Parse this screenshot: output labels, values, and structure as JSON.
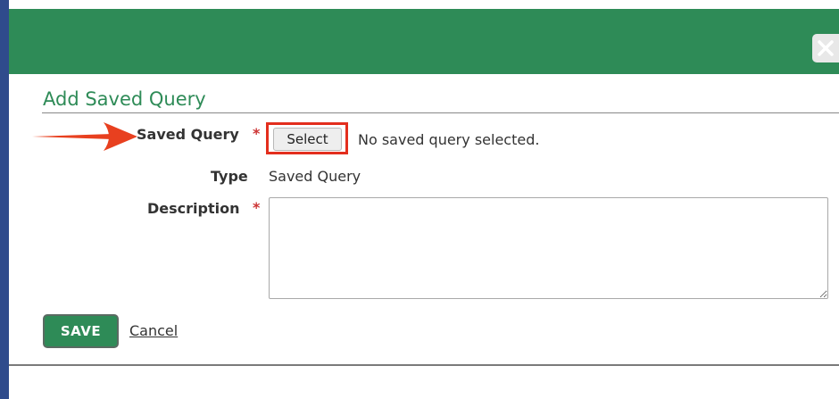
{
  "dialog": {
    "title": "Add Saved Query"
  },
  "form": {
    "saved_query": {
      "label": "Saved Query",
      "required_mark": "*",
      "select_button_label": "Select",
      "status_text": "No saved query selected."
    },
    "type": {
      "label": "Type",
      "value": "Saved Query"
    },
    "description": {
      "label": "Description",
      "required_mark": "*",
      "value": ""
    }
  },
  "actions": {
    "save_label": "SAVE",
    "cancel_label": "Cancel"
  },
  "icons": {
    "close": "close-icon",
    "annotation_arrow": "arrow-right-icon"
  },
  "colors": {
    "header_green": "#2e8b57",
    "title_green": "#2e8b57",
    "required_red": "#cc3333",
    "highlight_red": "#e32e1d",
    "left_border_blue": "#2f4b8c"
  }
}
